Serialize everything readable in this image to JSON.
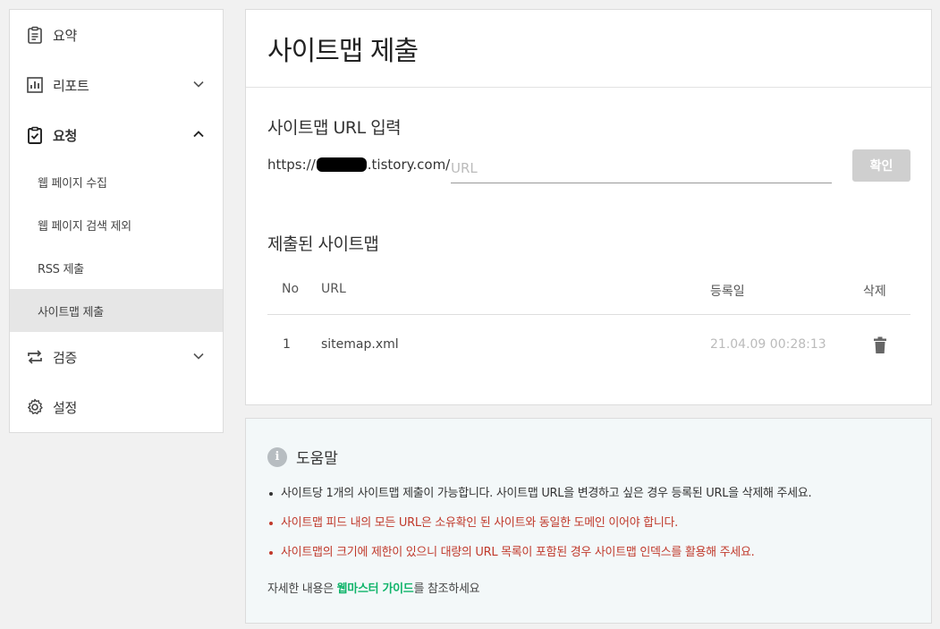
{
  "sidebar": {
    "items": [
      {
        "label": "요약",
        "icon": "clipboard-icon"
      },
      {
        "label": "리포트",
        "icon": "bar-chart-icon"
      },
      {
        "label": "요청",
        "icon": "clipboard-check-icon"
      },
      {
        "label": "검증",
        "icon": "swap-arrows-icon"
      },
      {
        "label": "설정",
        "icon": "gear-icon"
      }
    ],
    "subitems": [
      {
        "label": "웹 페이지 수집"
      },
      {
        "label": "웹 페이지 검색 제외"
      },
      {
        "label": "RSS 제출"
      },
      {
        "label": "사이트맵 제출"
      }
    ]
  },
  "main": {
    "title": "사이트맵 제출",
    "input_section_title": "사이트맵 URL 입력",
    "url_prefix_start": "https://",
    "url_prefix_end": ".tistory.com/",
    "url_placeholder": "URL",
    "confirm_label": "확인",
    "submitted_section_title": "제출된 사이트맵",
    "table": {
      "headers": {
        "no": "No",
        "url": "URL",
        "date": "등록일",
        "delete": "삭제"
      },
      "rows": [
        {
          "no": "1",
          "url": "sitemap.xml",
          "date": "21.04.09 00:28:13"
        }
      ]
    }
  },
  "help": {
    "title": "도움말",
    "bullets": [
      {
        "text": "사이트당 1개의 사이트맵 제출이 가능합니다. 사이트맵 URL을 변경하고 싶은 경우 등록된 URL을 삭제해 주세요.",
        "color": "#333333"
      },
      {
        "text": "사이트맵 피드 내의 모든 URL은 소유확인 된 사이트와 동일한 도메인 이어야 합니다.",
        "color": "#c0392b"
      },
      {
        "text": "사이트맵의 크기에 제한이 있으니 대량의 URL 목록이 포함된 경우 사이트맵 인덱스를 활용해 주세요.",
        "color": "#c0392b"
      }
    ],
    "footer_before": "자세한 내용은 ",
    "footer_link": "웹마스터 가이드",
    "footer_after": "를 참조하세요"
  },
  "colors": {
    "link": "#10b46a",
    "warning": "#c0392b",
    "button_disabled": "#cfcfcf"
  }
}
